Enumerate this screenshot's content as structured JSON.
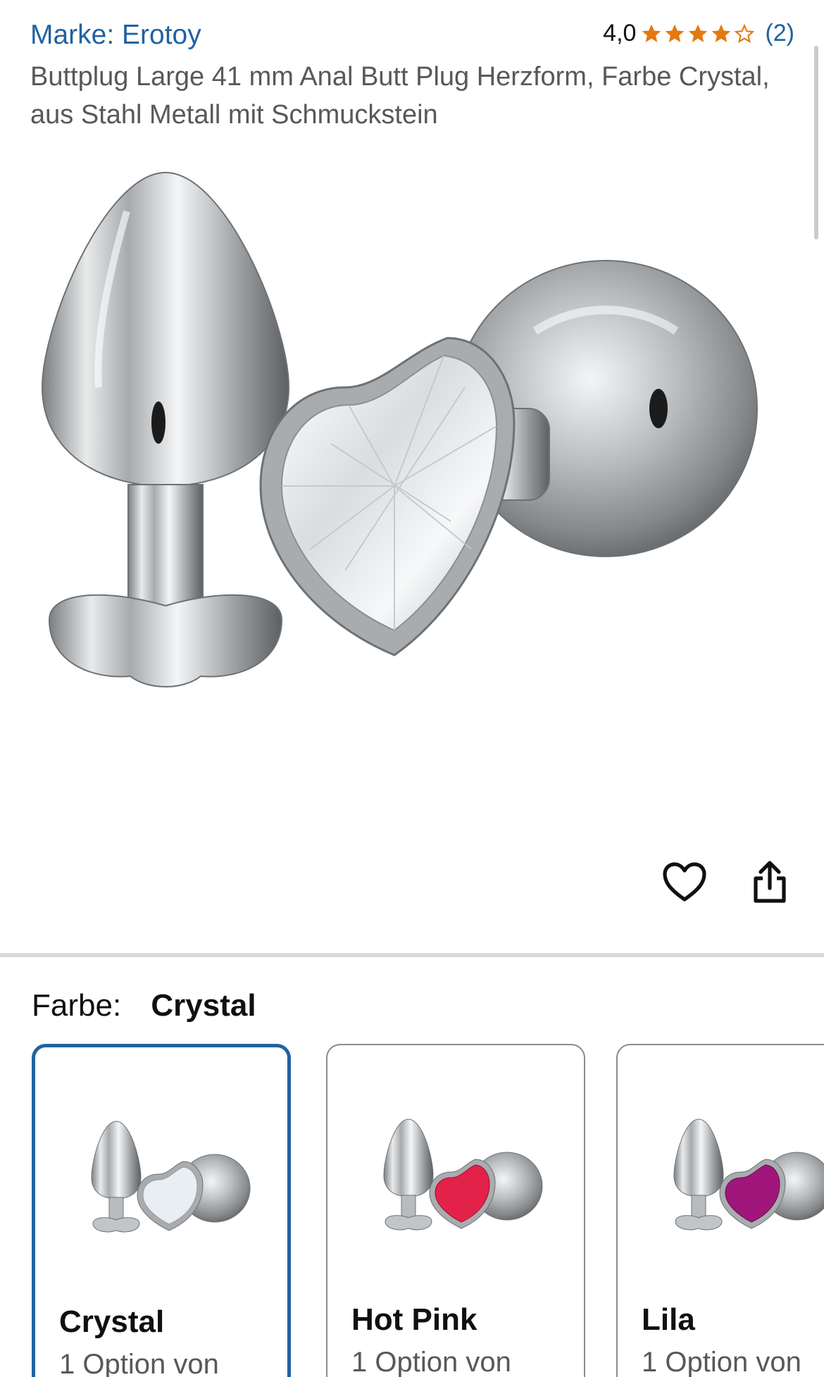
{
  "header": {
    "brand": "Marke: Erotoy",
    "rating_score": "4,0",
    "rating_count": "(2)",
    "stars": 4,
    "title": "Buttplug Large 41 mm Anal Butt Plug Herzform, Farbe Crystal, aus Stahl Metall mit Schmuckstein"
  },
  "colors": {
    "link": "#2162a1",
    "star": "#e47911",
    "text": "#0f1111",
    "muted": "#565959"
  },
  "actions": {
    "favorite_icon": "heart-outline-icon",
    "share_icon": "share-icon"
  },
  "variant": {
    "label": "Farbe:",
    "selected": "Crystal",
    "options": [
      {
        "name": "Crystal",
        "sub": "1 Option von",
        "gem": "#e9eef2"
      },
      {
        "name": "Hot Pink",
        "sub": "1 Option von",
        "gem": "#e3224a"
      },
      {
        "name": "Lila",
        "sub": "1 Option von",
        "gem": "#a1167a"
      }
    ]
  }
}
